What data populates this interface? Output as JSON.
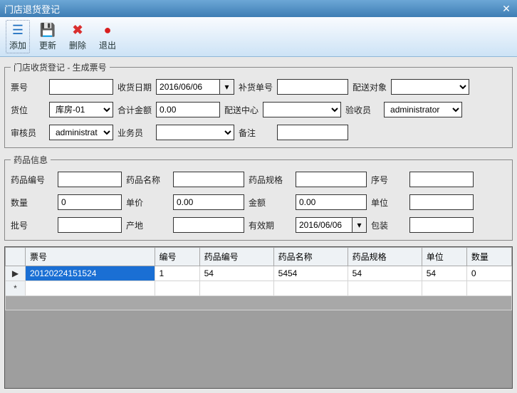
{
  "title": "门店退货登记",
  "toolbar": {
    "add": "添加",
    "refresh": "更新",
    "delete": "删除",
    "exit": "退出"
  },
  "group1": {
    "legend": "门店收货登记 - 生成票号",
    "fields": {
      "ticket_no_label": "票号",
      "ticket_no": "",
      "receive_date_label": "收货日期",
      "receive_date": "2016/06/06",
      "replenish_no_label": "补货单号",
      "replenish_no": "",
      "delivery_target_label": "配送对象",
      "delivery_target": "",
      "location_label": "货位",
      "location": "库房-01",
      "total_amount_label": "合计金额",
      "total_amount": "0.00",
      "distribution_center_label": "配送中心",
      "distribution_center": "",
      "inspector_label": "验收员",
      "inspector": "administrator",
      "auditor_label": "审核员",
      "auditor": "administrat",
      "salesman_label": "业务员",
      "salesman": "",
      "remark_label": "备注",
      "remark": ""
    }
  },
  "group2": {
    "legend": "药品信息",
    "fields": {
      "drug_code_label": "药品编号",
      "drug_code": "",
      "drug_name_label": "药品名称",
      "drug_name": "",
      "drug_spec_label": "药品规格",
      "drug_spec": "",
      "seq_label": "序号",
      "seq": "",
      "qty_label": "数量",
      "qty": "0",
      "price_label": "单价",
      "price": "0.00",
      "amount_label": "金额",
      "amount": "0.00",
      "unit_label": "单位",
      "unit": "",
      "batch_label": "批号",
      "batch": "",
      "origin_label": "产地",
      "origin": "",
      "expiry_label": "有效期",
      "expiry": "2016/06/06",
      "package_label": "包装",
      "package": ""
    }
  },
  "grid": {
    "headers": [
      "票号",
      "编号",
      "药品编号",
      "药品名称",
      "药品规格",
      "单位",
      "数量"
    ],
    "rows": [
      {
        "ticket": "20120224151524",
        "code": "1",
        "drug_code": "54",
        "drug_name": "5454",
        "drug_spec": "54",
        "unit": "54",
        "qty": "0"
      }
    ],
    "row_indicator_current": "▶",
    "row_indicator_new": "*"
  }
}
